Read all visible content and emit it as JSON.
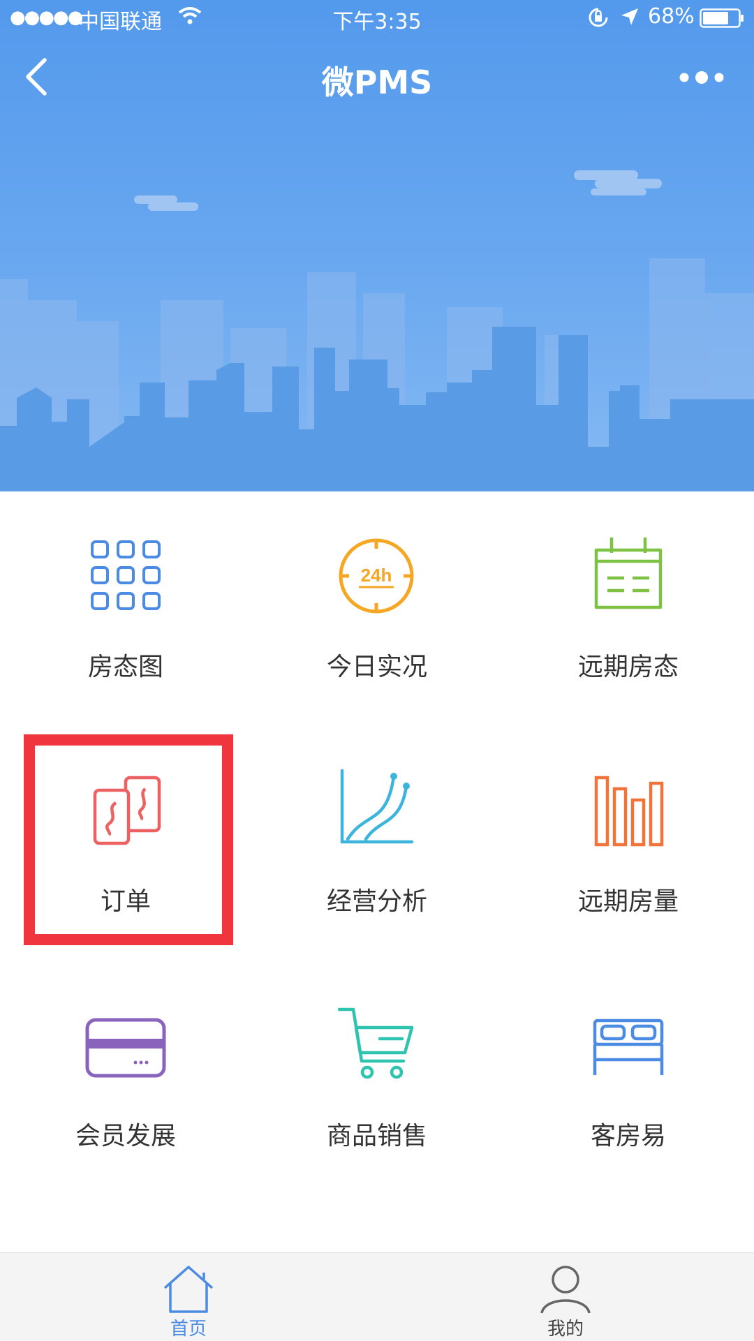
{
  "status_bar": {
    "signal": "●●●●●",
    "carrier": "中国联通",
    "time": "下午3:35",
    "battery": "68%"
  },
  "nav": {
    "title": "微PMS"
  },
  "icon_24h_text": "24h",
  "grid": {
    "items": [
      {
        "label": "房态图",
        "icon": "room-status-grid-icon",
        "color": "#4b8be3"
      },
      {
        "label": "今日实况",
        "icon": "clock-24h-icon",
        "color": "#f5a623"
      },
      {
        "label": "远期房态",
        "icon": "calendar-icon",
        "color": "#7dc243"
      },
      {
        "label": "订单",
        "icon": "order-cards-icon",
        "color": "#ec6161"
      },
      {
        "label": "经营分析",
        "icon": "line-chart-icon",
        "color": "#3cb4dc"
      },
      {
        "label": "远期房量",
        "icon": "bar-chart-icon",
        "color": "#f0733a"
      },
      {
        "label": "会员发展",
        "icon": "member-card-icon",
        "color": "#8a63bd"
      },
      {
        "label": "商品销售",
        "icon": "shopping-cart-icon",
        "color": "#2ec4b0"
      },
      {
        "label": "客房易",
        "icon": "bed-icon",
        "color": "#4b8be3"
      }
    ]
  },
  "tabbar": {
    "tabs": [
      {
        "label": "首页",
        "icon": "home-icon",
        "active": true,
        "color": "#4b8be3"
      },
      {
        "label": "我的",
        "icon": "user-icon",
        "active": false,
        "color": "#555555"
      }
    ]
  }
}
